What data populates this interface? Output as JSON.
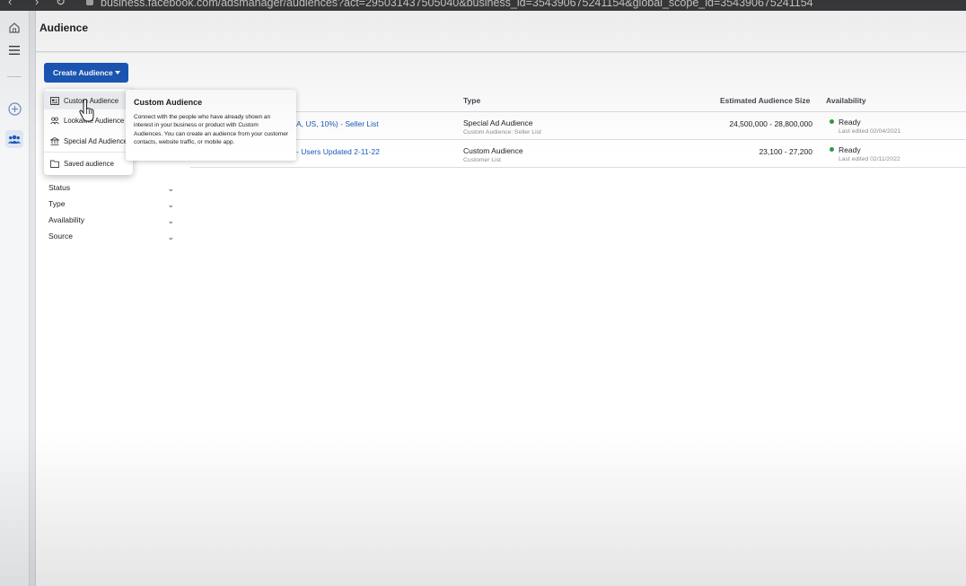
{
  "browser": {
    "url": "business.facebook.com/adsmanager/audiences?act=295031437505040&business_id=354390675241154&global_scope_id=354390675241154"
  },
  "header": {
    "title": "Audience"
  },
  "toolbar": {
    "create_label": "Create Audience"
  },
  "create_menu": {
    "items": [
      {
        "label": "Custom Audience",
        "icon": "custom-audience-icon"
      },
      {
        "label": "Lookalike Audience",
        "icon": "lookalike-audience-icon"
      },
      {
        "label": "Special Ad Audience",
        "icon": "special-ad-audience-icon"
      },
      {
        "label": "Saved audience",
        "icon": "saved-audience-icon"
      }
    ]
  },
  "tooltip": {
    "title": "Custom Audience",
    "body": "Connect with the people who have already shown an interest in your business or product with Custom Audiences. You can create an audience from your customer contacts, website traffic, or mobile app."
  },
  "filters": [
    {
      "label": "Status"
    },
    {
      "label": "Type"
    },
    {
      "label": "Availability"
    },
    {
      "label": "Source"
    }
  ],
  "table": {
    "columns": {
      "type": "Type",
      "size": "Estimated Audience Size",
      "availability": "Availability"
    },
    "rows": [
      {
        "name": "A, US, 10%) - Seller List",
        "type": "Special Ad Audience",
        "type_sub": "Custom Audience: Seller List",
        "size": "24,500,000 - 28,800,000",
        "status": "Ready",
        "edited": "Last edited 02/04/2021"
      },
      {
        "name": "- Users Updated 2-11-22",
        "type": "Custom Audience",
        "type_sub": "Customer List",
        "size": "23,100 - 27,200",
        "status": "Ready",
        "edited": "Last edited 02/11/2022"
      }
    ]
  },
  "colors": {
    "primary": "#1b58b8",
    "ready": "#2e9b3d"
  }
}
